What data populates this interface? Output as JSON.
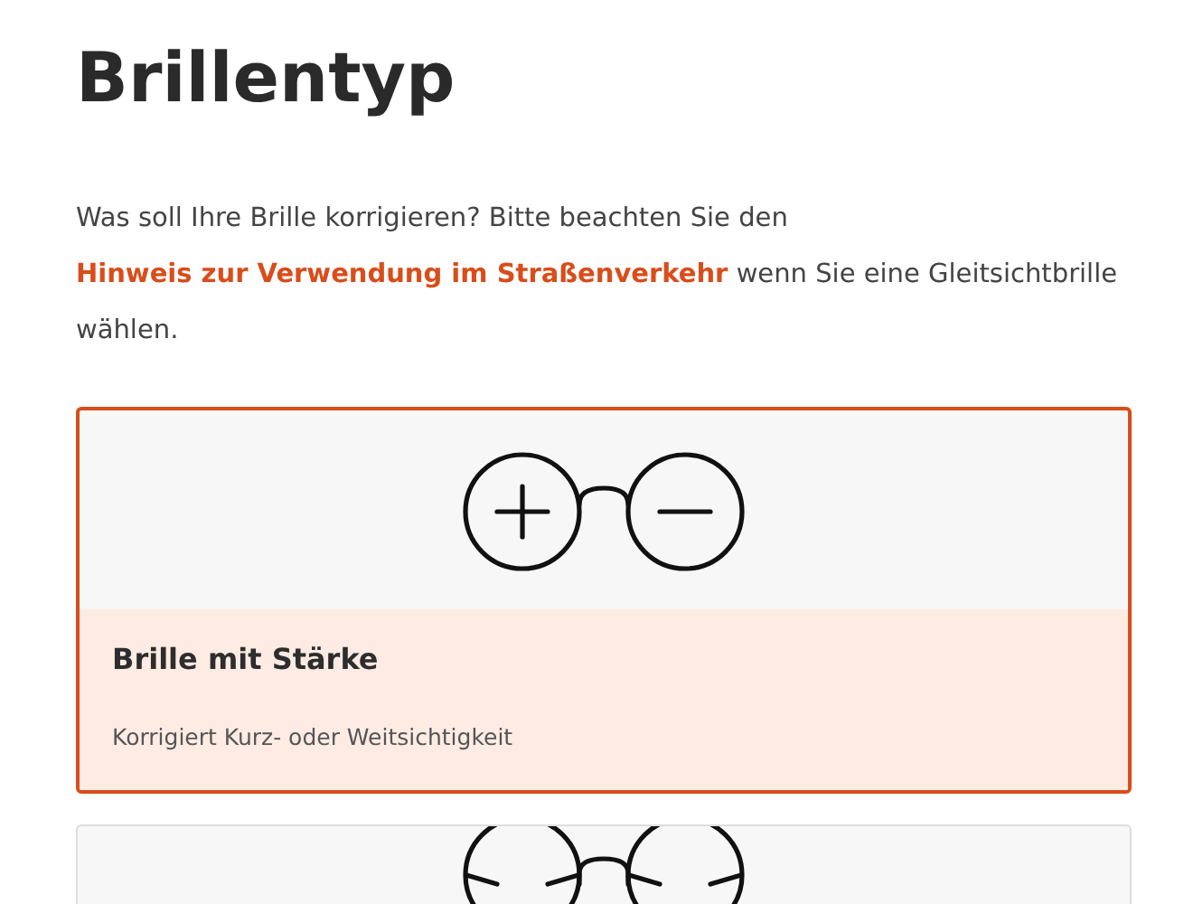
{
  "title": "Brillentyp",
  "intro": {
    "before": "Was soll Ihre Brille korrigieren? Bitte beachten Sie den",
    "link": "Hinweis zur Verwendung im Straßenverkehr",
    "after": "wenn Sie eine Gleitsichtbrille wählen."
  },
  "options": [
    {
      "kind": "single",
      "selected": true,
      "title": "Brille mit Stärke",
      "description": "Korrigiert Kurz- oder Weitsichtigkeit"
    },
    {
      "kind": "progressive",
      "selected": false
    }
  ]
}
